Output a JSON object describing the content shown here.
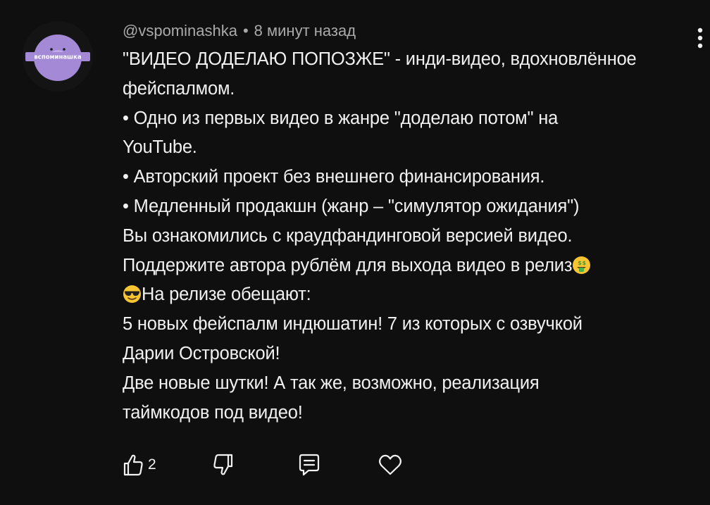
{
  "comment": {
    "author": "@vspominashka",
    "separator": "•",
    "time": "8 минут назад",
    "avatar_text": "вспоминашка",
    "lines": {
      "l1": "\"ВИДЕО ДОДЕЛАЮ ПОПОЗЖЕ\" - инди-видео, вдохновлённое",
      "l2": "фейспалмом.",
      "l3": "• Одно из первых видео в жанре \"доделаю потом\" на",
      "l4": "YouTube.",
      "l5": "• Авторский проект без внешнего финансирования.",
      "l6": "• Медленный продакшн (жанр – \"симулятор ожидания\")",
      "l7": "Вы ознакомились с краудфандинговой версией видео.",
      "l8": "Поддержите автора рублём для выхода видео в релиз",
      "l9": "На релизе обещают:",
      "l10": "5 новых фейспалм индюшатин! 7 из которых с озвучкой",
      "l11": "Дарии Островской!",
      "l12": "Две новые шутки! А так же, возможно, реализация",
      "l13": "таймкодов под видео!"
    },
    "emojis": {
      "after_l8": "money-mouth-face-emoji",
      "before_l9": "sunglasses-face-emoji"
    },
    "actions": {
      "like_count": "2"
    }
  },
  "icons": [
    "vertical-dots-icon",
    "thumbs-up-icon",
    "thumbs-down-icon",
    "reply-icon",
    "heart-icon"
  ],
  "colors": {
    "background": "#0f0f0f",
    "text": "#f1f1f1",
    "meta_text": "#aaaaaa",
    "avatar_purple": "#a389d6"
  }
}
